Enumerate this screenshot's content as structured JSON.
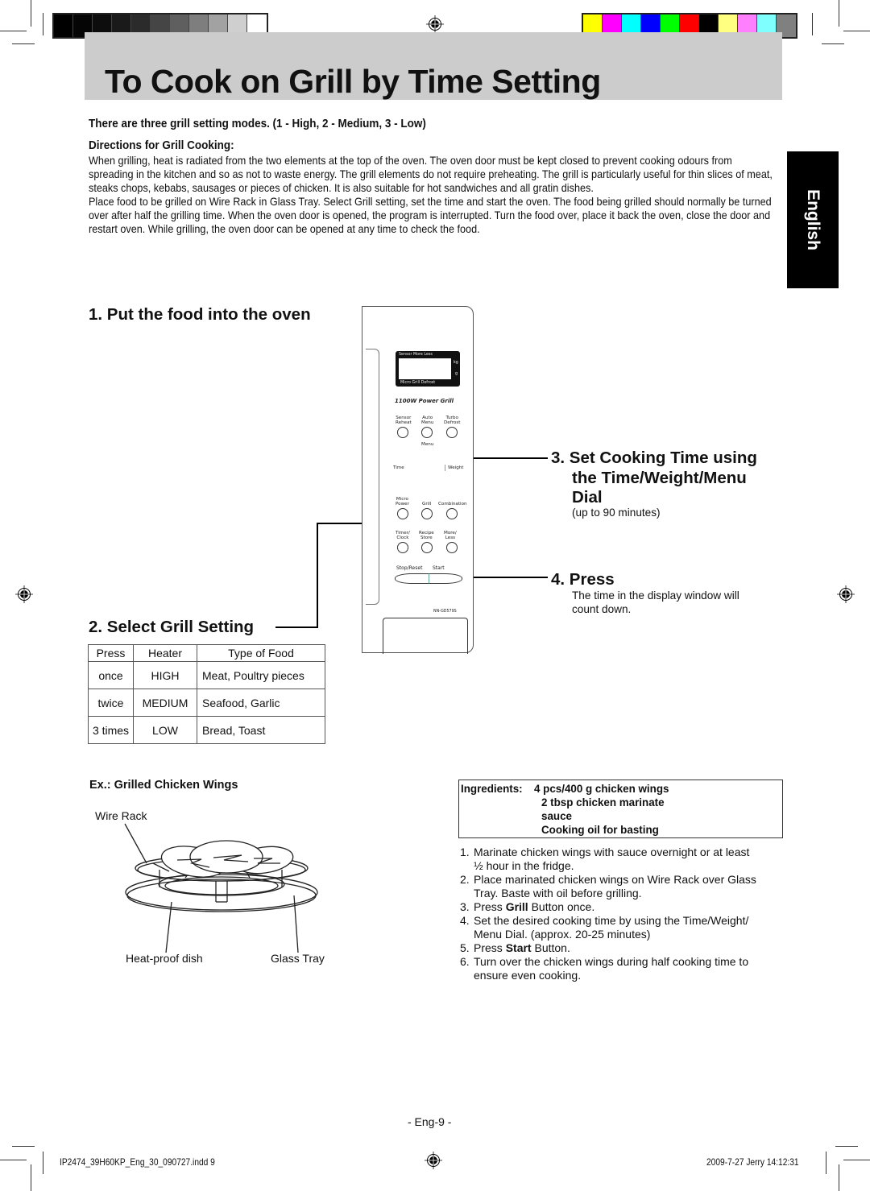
{
  "page": {
    "title": "To Cook on Grill by Time Setting",
    "language_tab": "English",
    "intro_heading": "There are three grill setting modes. (1 - High, 2 - Medium, 3 - Low)",
    "directions_heading": "Directions for Grill Cooking:",
    "directions_paragraphs": [
      "When grilling, heat is radiated from the two elements at the top of the oven. The oven door must be kept closed to prevent cooking odours from spreading in the kitchen and so as not to waste energy. The grill elements do not require preheating. The grill is particularly useful for thin slices of meat, steaks chops, kebabs, sausages or pieces of chicken. It is also suitable for hot sandwiches and all gratin dishes.",
      "Place food to be grilled on Wire Rack in Glass Tray. Select Grill setting, set the time and start the oven. The food being grilled should normally be turned over after half the grilling time. When the oven door is opened, the program is interrupted. Turn the food over, place it back the oven, close the door and restart oven. While grilling, the oven door can be opened at any time to check the food."
    ]
  },
  "color_bars": {
    "grayscale": [
      "#000000",
      "#050505",
      "#0d0d0d",
      "#1a1a1a",
      "#2b2b2b",
      "#454545",
      "#5f5f5f",
      "#7e7e7e",
      "#a2a2a2",
      "#cfcfcf",
      "#ffffff"
    ],
    "process": [
      "#ffff00",
      "#ff00ff",
      "#00ffff",
      "#0000ff",
      "#00ff00",
      "#ff0000",
      "#000000",
      "#ffff80",
      "#ff80ff",
      "#80ffff",
      "#808080"
    ]
  },
  "steps": {
    "step1": "1. Put the food into the oven",
    "step2": "2. Select Grill Setting",
    "step3_line1": "3. Set Cooking Time using",
    "step3_line2": "the Time/Weight/Menu",
    "step3_line3": "Dial",
    "step3_note": "(up to 90 minutes)",
    "step4": "4. Press",
    "step4_note_line1": "The time in the display window will",
    "step4_note_line2": "count down."
  },
  "control_panel": {
    "display_top": "Sensor  More  Less",
    "display_bottom": "Micro  Grill  Defrost",
    "display_unit_kg": "kg",
    "display_unit_g": "g",
    "brand": "1100W Power Grill",
    "buttons_row1": [
      {
        "line1": "Sensor",
        "line2": "Reheat"
      },
      {
        "line1": "Auto",
        "line2": "Menu"
      },
      {
        "line1": "Turbo",
        "line2": "Defrost"
      }
    ],
    "menu_label": "Menu",
    "time_label": "Time",
    "weight_label": "Weight",
    "buttons_row2": [
      {
        "line1": "Micro",
        "line2": "Power"
      },
      {
        "line1": "",
        "line2": "Grill"
      },
      {
        "line1": "",
        "line2": "Combination"
      }
    ],
    "buttons_row3": [
      {
        "line1": "Timer/",
        "line2": "Clock"
      },
      {
        "line1": "Recipe",
        "line2": "Store"
      },
      {
        "line1": "More/",
        "line2": "Less"
      }
    ],
    "stop_reset": "Stop/Reset",
    "start": "Start",
    "model": "NN-GD579S"
  },
  "grill_table": {
    "headers": [
      "Press",
      "Heater",
      "Type of Food"
    ],
    "rows": [
      [
        "once",
        "HIGH",
        "Meat, Poultry pieces"
      ],
      [
        "twice",
        "MEDIUM",
        "Seafood, Garlic"
      ],
      [
        "3 times",
        "LOW",
        "Bread, Toast"
      ]
    ]
  },
  "example": {
    "heading": "Ex.: Grilled Chicken Wings",
    "labels": {
      "wire_rack": "Wire Rack",
      "heat_proof_dish": "Heat-proof dish",
      "glass_tray": "Glass Tray"
    },
    "ingredients_label": "Ingredients:",
    "ingredients": [
      "4 pcs/400 g chicken wings",
      "2 tbsp chicken marinate",
      "sauce",
      "Cooking oil for basting"
    ],
    "instructions": [
      {
        "num": "1.",
        "pre": "Marinate chicken wings with sauce overnight or at least ",
        "bold": "",
        "post": "",
        "line2": "½ hour in the fridge."
      },
      {
        "num": "2.",
        "pre": "Place marinated chicken wings on Wire Rack over Glass",
        "bold": "",
        "post": "",
        "line2": "Tray. Baste with oil before grilling."
      },
      {
        "num": "3.",
        "pre": "Press ",
        "bold": "Grill",
        "post": " Button once.",
        "line2": ""
      },
      {
        "num": "4.",
        "pre": "Set the desired cooking time by using the Time/Weight/",
        "bold": "",
        "post": "",
        "line2": "Menu Dial. (approx. 20-25 minutes)"
      },
      {
        "num": "5.",
        "pre": "Press ",
        "bold": "Start",
        "post": " Button.",
        "line2": ""
      },
      {
        "num": "6.",
        "pre": "Turn over the chicken wings during half cooking time to",
        "bold": "",
        "post": "",
        "line2": "ensure even cooking."
      }
    ]
  },
  "footer": {
    "page_number": "- Eng-9 -",
    "file_name": "IP2474_39H60KP_Eng_30_090727.indd  9",
    "timestamp": "2009-7-27  Jerry 14:12:31"
  }
}
